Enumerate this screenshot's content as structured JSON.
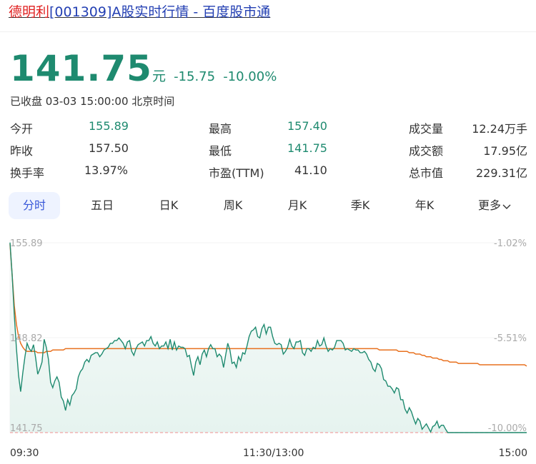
{
  "page": {
    "title_highlight": "德明利",
    "title_rest": "[001309]A股实时行情 - 百度股市通"
  },
  "quote": {
    "price": "141.75",
    "unit": "元",
    "change": "-15.75",
    "change_pct": "-10.00%",
    "status": "已收盘 03-03 15:00:00 北京时间"
  },
  "stats": [
    {
      "label": "今开",
      "value": "155.89",
      "color": "green"
    },
    {
      "label": "最高",
      "value": "157.40",
      "color": "green"
    },
    {
      "label": "成交量",
      "value": "12.24万手",
      "color": "normal"
    },
    {
      "label": "昨收",
      "value": "157.50",
      "color": "normal"
    },
    {
      "label": "最低",
      "value": "141.75",
      "color": "green"
    },
    {
      "label": "成交额",
      "value": "17.95亿",
      "color": "normal"
    },
    {
      "label": "换手率",
      "value": "13.97%",
      "color": "normal"
    },
    {
      "label": "市盈(TTM)",
      "value": "41.10",
      "color": "normal"
    },
    {
      "label": "总市值",
      "value": "229.31亿",
      "color": "normal"
    }
  ],
  "tabs": [
    "分时",
    "五日",
    "日K",
    "周K",
    "月K",
    "季K",
    "年K",
    "更多"
  ],
  "active_tab": 0,
  "colors": {
    "green": "#1e8a6f",
    "price_line": "#1e8a6f",
    "avg_line": "#e8701e",
    "area_fill": "#e6f3ef",
    "limit_line": "#f0a3a3",
    "accent": "#3656d8"
  },
  "chart_data": {
    "type": "line",
    "x_labels": [
      "09:30",
      "11:30/13:00",
      "15:00"
    ],
    "y_left_ticks": [
      "155.89",
      "148.82",
      "141.75"
    ],
    "y_right_ticks": [
      "-1.02%",
      "-5.51%",
      "-10.00%"
    ],
    "ylim": [
      141.75,
      155.89
    ],
    "series": [
      {
        "values": [
          155.9,
          153.5,
          150.5,
          148.0,
          146.0,
          144.8,
          146.2,
          147.4,
          148.4,
          148.0,
          147.8,
          148.3,
          147.3,
          146.1,
          146.5,
          147.0,
          148.7,
          148.1,
          147.2,
          145.5,
          145.1,
          145.6,
          145.9,
          145.5,
          144.4,
          144.1,
          143.4,
          144.2,
          143.8,
          144.5,
          144.7,
          145.0,
          145.9,
          146.3,
          146.5,
          147.0,
          147.2,
          147.0,
          147.5,
          147.6,
          147.7,
          147.7,
          147.4,
          147.6,
          147.9,
          148.0,
          148.1,
          148.4,
          148.4,
          148.6,
          148.6,
          148.8,
          148.6,
          148.4,
          148.0,
          148.5,
          148.6,
          147.8,
          147.5,
          148.0,
          148.3,
          148.4,
          148.5,
          148.2,
          148.6,
          148.6,
          148.9,
          148.4,
          148.2,
          148.5,
          148.0,
          148.2,
          148.2,
          148.5,
          148.0,
          148.7,
          147.9,
          148.5,
          147.9,
          148.2,
          148.1,
          148.1,
          148.0,
          147.4,
          147.5,
          146.7,
          146.0,
          147.0,
          147.4,
          146.8,
          147.6,
          147.9,
          147.4,
          148.0,
          148.3,
          148.0,
          148.0,
          147.4,
          147.6,
          147.4,
          146.6,
          147.5,
          148.4,
          147.9,
          146.9,
          147.0,
          146.6,
          147.4,
          147.1,
          147.7,
          147.6,
          148.2,
          148.9,
          149.3,
          149.4,
          149.6,
          148.9,
          148.8,
          149.5,
          149.8,
          149.1,
          149.6,
          149.6,
          148.9,
          148.4,
          148.3,
          148.4,
          148.3,
          147.6,
          147.8,
          148.1,
          148.7,
          148.2,
          148.0,
          148.5,
          148.5,
          148.6,
          147.7,
          147.5,
          148.0,
          148.0,
          147.8,
          148.1,
          148.0,
          148.6,
          148.2,
          148.3,
          148.8,
          148.2,
          147.8,
          148.0,
          147.9,
          148.1,
          148.6,
          148.6,
          148.6,
          148.4,
          147.9,
          148.0,
          147.9,
          147.8,
          148.0,
          147.9,
          147.9,
          147.7,
          147.7,
          147.8,
          147.6,
          147.2,
          147.0,
          146.5,
          146.3,
          146.9,
          146.8,
          146.5,
          145.7,
          145.6,
          145.2,
          145.2,
          145.0,
          144.7,
          145.1,
          145.0,
          144.2,
          144.2,
          143.5,
          143.2,
          143.6,
          143.3,
          142.8,
          142.4,
          142.8,
          142.6,
          142.0,
          142.2,
          142.4,
          142.1,
          141.8,
          142.2,
          142.3,
          142.6,
          142.1,
          142.3,
          142.3,
          142.0,
          141.75,
          141.75,
          141.75,
          141.75,
          141.75,
          141.75,
          141.75,
          141.75,
          141.75,
          141.75,
          141.75,
          141.75,
          141.75,
          141.75,
          141.75,
          141.75,
          141.75,
          141.75,
          141.75,
          141.75,
          141.75,
          141.75,
          141.75,
          141.75,
          141.75,
          141.75,
          141.75,
          141.75,
          141.75,
          141.75,
          141.75,
          141.75,
          141.75,
          141.75,
          141.75,
          141.75,
          141.75,
          141.75
        ]
      },
      {
        "values": [
          155.8,
          153.5,
          151.2,
          149.8,
          148.9,
          148.4,
          148.1,
          147.9,
          147.8,
          147.8,
          147.8,
          147.8,
          147.8,
          147.7,
          147.7,
          147.7,
          147.7,
          147.8,
          147.8,
          147.8,
          147.9,
          147.9,
          147.9,
          147.9,
          147.9,
          147.9,
          148.0,
          148.0,
          148.0,
          148.0,
          148.0,
          148.0,
          148.0,
          148.0,
          148.0,
          148.0,
          148.0,
          148.0,
          148.0,
          148.0,
          148.0,
          148.0,
          148.0,
          148.0,
          148.0,
          148.0,
          148.0,
          148.0,
          148.0,
          148.0,
          148.0,
          148.0,
          148.0,
          148.0,
          148.0,
          148.0,
          148.0,
          148.0,
          148.0,
          148.0,
          148.0,
          148.0,
          148.0,
          148.0,
          148.0,
          148.0,
          148.0,
          148.0,
          148.0,
          148.0,
          148.0,
          148.0,
          148.0,
          148.0,
          148.0,
          148.0,
          148.0,
          148.0,
          148.0,
          148.0,
          148.0,
          148.0,
          148.0,
          148.0,
          148.0,
          148.0,
          148.0,
          148.0,
          148.0,
          148.0,
          148.0,
          148.0,
          148.0,
          148.0,
          148.0,
          148.0,
          148.0,
          148.0,
          148.0,
          148.0,
          148.0,
          148.0,
          148.0,
          148.0,
          148.0,
          148.0,
          148.0,
          148.0,
          148.0,
          148.0,
          148.0,
          148.0,
          148.0,
          148.0,
          148.0,
          148.0,
          148.0,
          148.0,
          148.0,
          148.0,
          148.0,
          148.0,
          148.0,
          148.0,
          148.0,
          148.0,
          148.0,
          148.0,
          148.0,
          148.0,
          148.0,
          148.0,
          148.0,
          148.0,
          148.0,
          148.0,
          148.0,
          148.0,
          148.0,
          148.0,
          148.0,
          148.0,
          148.0,
          148.0,
          148.0,
          148.0,
          148.0,
          148.0,
          148.0,
          148.0,
          148.0,
          148.0,
          148.0,
          148.0,
          148.0,
          148.0,
          148.0,
          148.0,
          148.0,
          148.0,
          148.0,
          148.0,
          148.0,
          148.0,
          148.0,
          148.0,
          148.0,
          148.0,
          148.0,
          148.0,
          148.0,
          148.0,
          148.0,
          147.9,
          147.9,
          147.9,
          147.9,
          147.9,
          147.9,
          147.9,
          147.9,
          147.9,
          147.8,
          147.8,
          147.8,
          147.8,
          147.8,
          147.7,
          147.7,
          147.7,
          147.6,
          147.6,
          147.6,
          147.5,
          147.5,
          147.4,
          147.4,
          147.4,
          147.3,
          147.3,
          147.3,
          147.2,
          147.2,
          147.1,
          147.1,
          147.1,
          147.0,
          147.0,
          147.0,
          147.0,
          146.9,
          146.9,
          146.9,
          146.9,
          146.9,
          146.9,
          146.9,
          146.9,
          146.9,
          146.9,
          146.8,
          146.8,
          146.8,
          146.8,
          146.8,
          146.8,
          146.8,
          146.8,
          146.8,
          146.8,
          146.8,
          146.8,
          146.8,
          146.8,
          146.8,
          146.8,
          146.8,
          146.8,
          146.8,
          146.8,
          146.8,
          146.8,
          146.7
        ]
      }
    ]
  }
}
